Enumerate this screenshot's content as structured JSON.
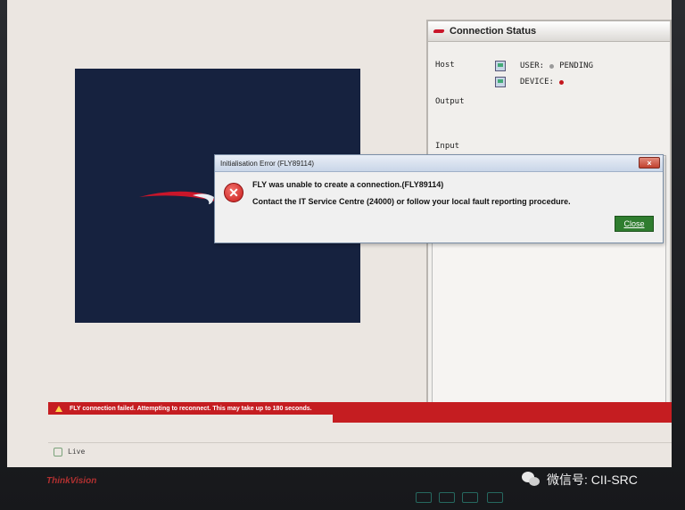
{
  "connection_status": {
    "title": "Connection Status",
    "host_label": "Host",
    "output_label": "Output",
    "input_label": "Input",
    "user_label": "USER:",
    "user_value": "PENDING",
    "device_label": "DEVICE:",
    "user_dot_color": "#9a9a9a",
    "device_dot_color": "#c4161c"
  },
  "error_dialog": {
    "title": "Initialisation Error (FLY89114)",
    "close_x": "×",
    "icon": "error-x-icon",
    "message_line1": "FLY was unable to create a connection.(FLY89114)",
    "message_line2": "Contact the IT Service Centre (24000) or follow your local fault reporting procedure.",
    "close_button_label": "Close"
  },
  "status_banner": {
    "text": "FLY connection failed. Attempting to reconnect. This may take up to 180 seconds.",
    "color": "#c51d21"
  },
  "status_bar": {
    "live_label": "Live"
  },
  "monitor": {
    "brand": "ThinkVision"
  },
  "watermark": {
    "text": "微信号: CII-SRC"
  },
  "colors": {
    "splash_background": "#16223f",
    "brand_red": "#c9162a",
    "close_button": "#2f7d2f"
  }
}
